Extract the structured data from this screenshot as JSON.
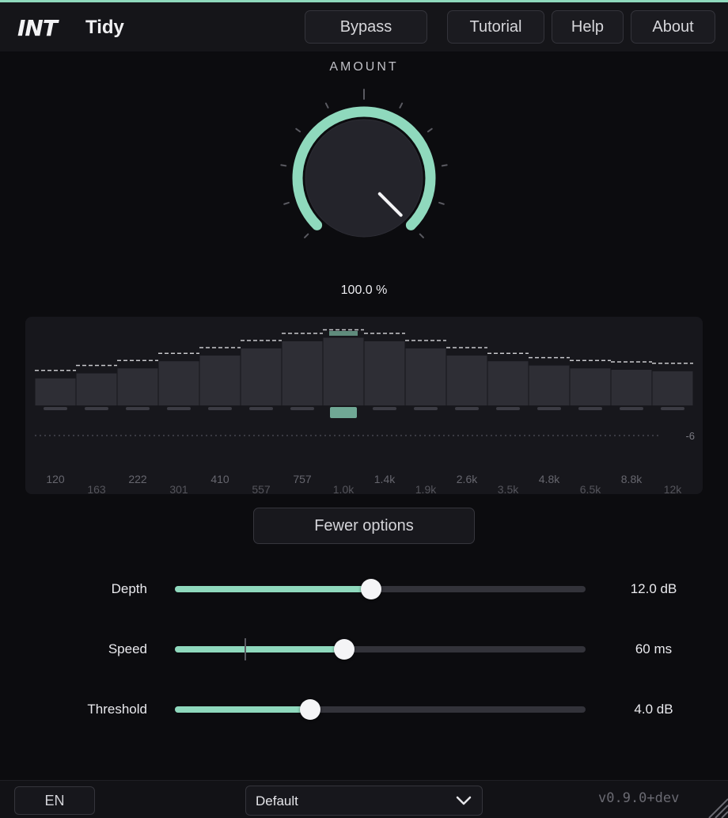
{
  "header": {
    "logo_text": "INT",
    "title": "Tidy",
    "buttons": [
      {
        "label": "Bypass"
      },
      {
        "label": "Tutorial"
      },
      {
        "label": "Help"
      },
      {
        "label": "About"
      }
    ]
  },
  "amount": {
    "label": "AMOUNT",
    "value_text": "100.0 %",
    "value": 1.0
  },
  "eq": {
    "scale_label": "-6",
    "freq_labels_top": [
      "120",
      "222",
      "410",
      "757",
      "1.4k",
      "2.6k",
      "4.8k",
      "8.8k"
    ],
    "freq_labels_bottom": [
      "163",
      "301",
      "557",
      "1.0k",
      "1.9k",
      "3.5k",
      "6.5k",
      "12k"
    ],
    "band_levels": [
      0.38,
      0.45,
      0.52,
      0.62,
      0.7,
      0.8,
      0.9,
      0.95,
      0.9,
      0.8,
      0.7,
      0.62,
      0.56,
      0.52,
      0.5,
      0.48
    ],
    "active_band": 7
  },
  "options_button": {
    "label": "Fewer options"
  },
  "sliders": [
    {
      "label": "Depth",
      "value_text": "12.0 dB",
      "fraction": 0.478
    },
    {
      "label": "Speed",
      "value_text": "60 ms",
      "fraction": 0.413,
      "marker": 0.17
    },
    {
      "label": "Threshold",
      "value_text": "4.0 dB",
      "fraction": 0.33
    }
  ],
  "footer": {
    "language": "EN",
    "preset": "Default",
    "version": "v0.9.0+dev"
  },
  "colors": {
    "accent": "#8fd9bd",
    "background": "#0c0c0f",
    "panel": "#17171c"
  }
}
